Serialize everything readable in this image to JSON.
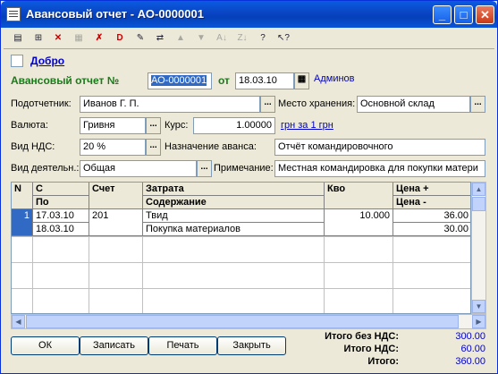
{
  "window": {
    "title": "Авансовый отчет - АО-0000001",
    "minimize": "_",
    "maximize": "□",
    "close": "✕"
  },
  "toolbar": {
    "icons": [
      "new-icon",
      "copy-icon",
      "delete-icon",
      "group-icon",
      "delete-mark-icon",
      "delete-red-icon",
      "edit-icon",
      "move-icon",
      "up-arrow-icon",
      "down-arrow-icon",
      "sort-asc-icon",
      "sort-desc-icon",
      "help-icon",
      "whats-this-icon"
    ]
  },
  "dobro": {
    "label": "Добро"
  },
  "header": {
    "doc_label": "Авансовый отчет №",
    "doc_number": "АО-0000001",
    "date_label": "от",
    "date": "18.03.10",
    "user": "Админов"
  },
  "fields": {
    "podotchetnik_label": "Подотчетник:",
    "podotchetnik": "Иванов Г. П.",
    "mesto_label": "Место хранения:",
    "mesto": "Основной склад",
    "valuta_label": "Валюта:",
    "valuta": "Гривня",
    "kurs_label": "Курс:",
    "kurs": "1.00000",
    "kurs_link": "грн за 1 грн",
    "nds_label": "Вид НДС:",
    "nds": "20 %",
    "naznachenie_label": "Назначение аванса:",
    "naznachenie": "Отчёт командировочного",
    "vid_label": "Вид деятельн.:",
    "vid": "Общая",
    "primechanie_label": "Примечание:",
    "primechanie": "Местная командировка для покупки матери"
  },
  "table": {
    "headers": {
      "n": "N",
      "c": "С",
      "po": "По",
      "schet": "Счет",
      "zatrata": "Затрата",
      "soderzhanie": "Содержание",
      "kvo": "Кво",
      "cena_plus": "Цена +",
      "cena_minus": "Цена -"
    },
    "rows": [
      {
        "n": "1",
        "c": "17.03.10",
        "po": "18.03.10",
        "schet": "201",
        "zatrata": "Твид",
        "soderzhanie": "Покупка материалов",
        "kvo": "10.000",
        "cena_plus": "36.00",
        "cena_minus": "30.00"
      }
    ]
  },
  "buttons": {
    "ok": "ОК",
    "save": "Записать",
    "print": "Печать",
    "close": "Закрыть"
  },
  "totals": {
    "bez_nds_label": "Итого без НДС:",
    "bez_nds": "300.00",
    "nds_label": "Итого НДС:",
    "nds": "60.00",
    "itogo_label": "Итого:",
    "itogo": "360.00"
  }
}
